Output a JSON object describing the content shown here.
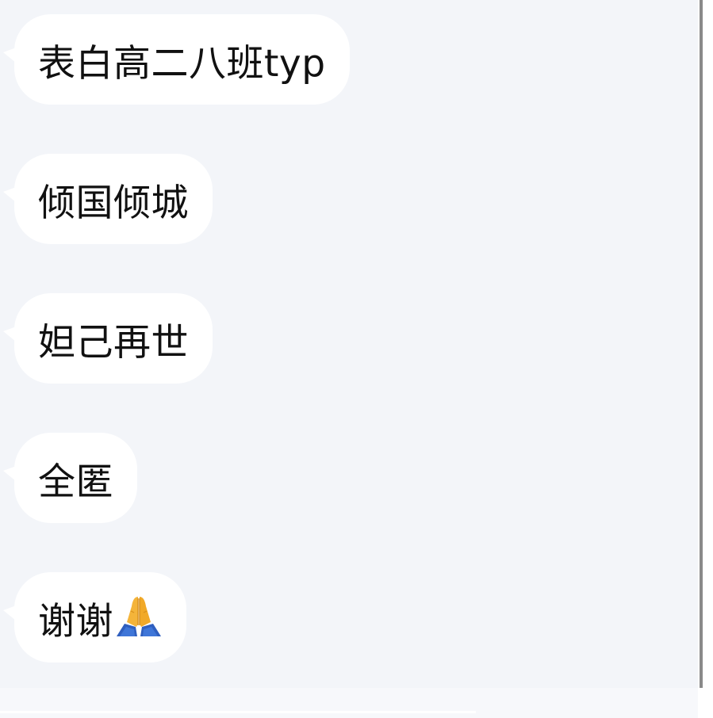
{
  "messages": [
    {
      "text": "表白高二八班typ"
    },
    {
      "text": "倾国倾城"
    },
    {
      "text": "妲己再世"
    },
    {
      "text": "全匿"
    },
    {
      "text": "谢谢",
      "emoji": "folded-hands-icon"
    }
  ],
  "colors": {
    "background": "#f3f5f9",
    "bubble": "#ffffff",
    "text": "#111111",
    "scrollbar": "#8a8a8a"
  }
}
